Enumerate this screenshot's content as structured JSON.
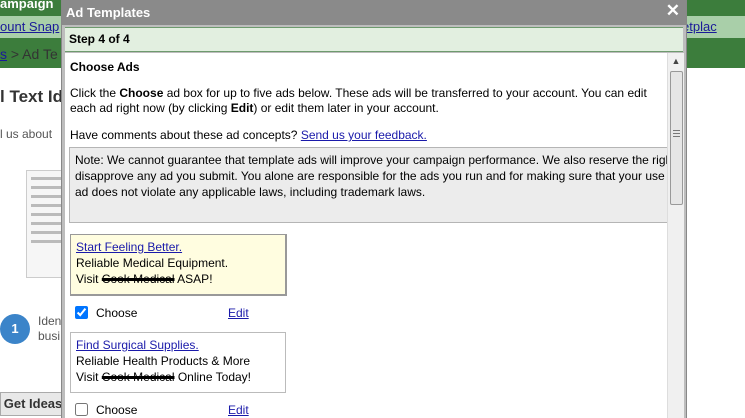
{
  "background": {
    "header_title": "ampaign",
    "subnav_left": "ount Snap",
    "subnav_right": "etplac",
    "breadcrumb_link": "s",
    "breadcrumb_rest": "> Ad Te",
    "heading": "l Text Id",
    "intro_text": "l us about",
    "step_number": "1",
    "step_text_line1": "Iden",
    "step_text_line2": "busi",
    "button_label": "Get Ideas"
  },
  "dialog": {
    "title": "Ad Templates",
    "close_icon": "close-icon",
    "step_label": "Step 4 of 4",
    "section_title": "Choose Ads",
    "instructions_part1": "Click the ",
    "instructions_choose": "Choose",
    "instructions_part2": " ad box for up to five ads below. These ads will be transferred to your account. You can edit each ad right now (by clicking ",
    "instructions_edit": "Edit",
    "instructions_part3": ") or edit them later in your account.",
    "comments_text": "Have comments about these ad concepts? ",
    "feedback_link": "Send us your feedback.",
    "note": "Note: We cannot guarantee that template ads will improve your campaign performance. We also reserve the right to disapprove any ad you submit. You alone are responsible for the ads you run and for making sure that your use of an ad does not violate any applicable laws, including trademark laws."
  },
  "ads": [
    {
      "headline": "Start Feeling Better.",
      "line1": "Reliable Medical Equipment.",
      "line2_prefix": "Visit ",
      "line2_redacted": "Cook Medical",
      "line2_suffix": " ASAP!",
      "choose_label": "Choose",
      "checked": true,
      "edit_label": "Edit"
    },
    {
      "headline": "Find Surgical Supplies.",
      "line1": "Reliable Health Products & More",
      "line2_prefix": "Visit ",
      "line2_redacted": "Cook Medical",
      "line2_suffix": " Online Today!",
      "choose_label": "Choose",
      "checked": false,
      "edit_label": "Edit"
    }
  ],
  "colors": {
    "link": "#1a1aaa",
    "step_bar": "#e2efe0",
    "titlebar": "#8a8a8a"
  }
}
